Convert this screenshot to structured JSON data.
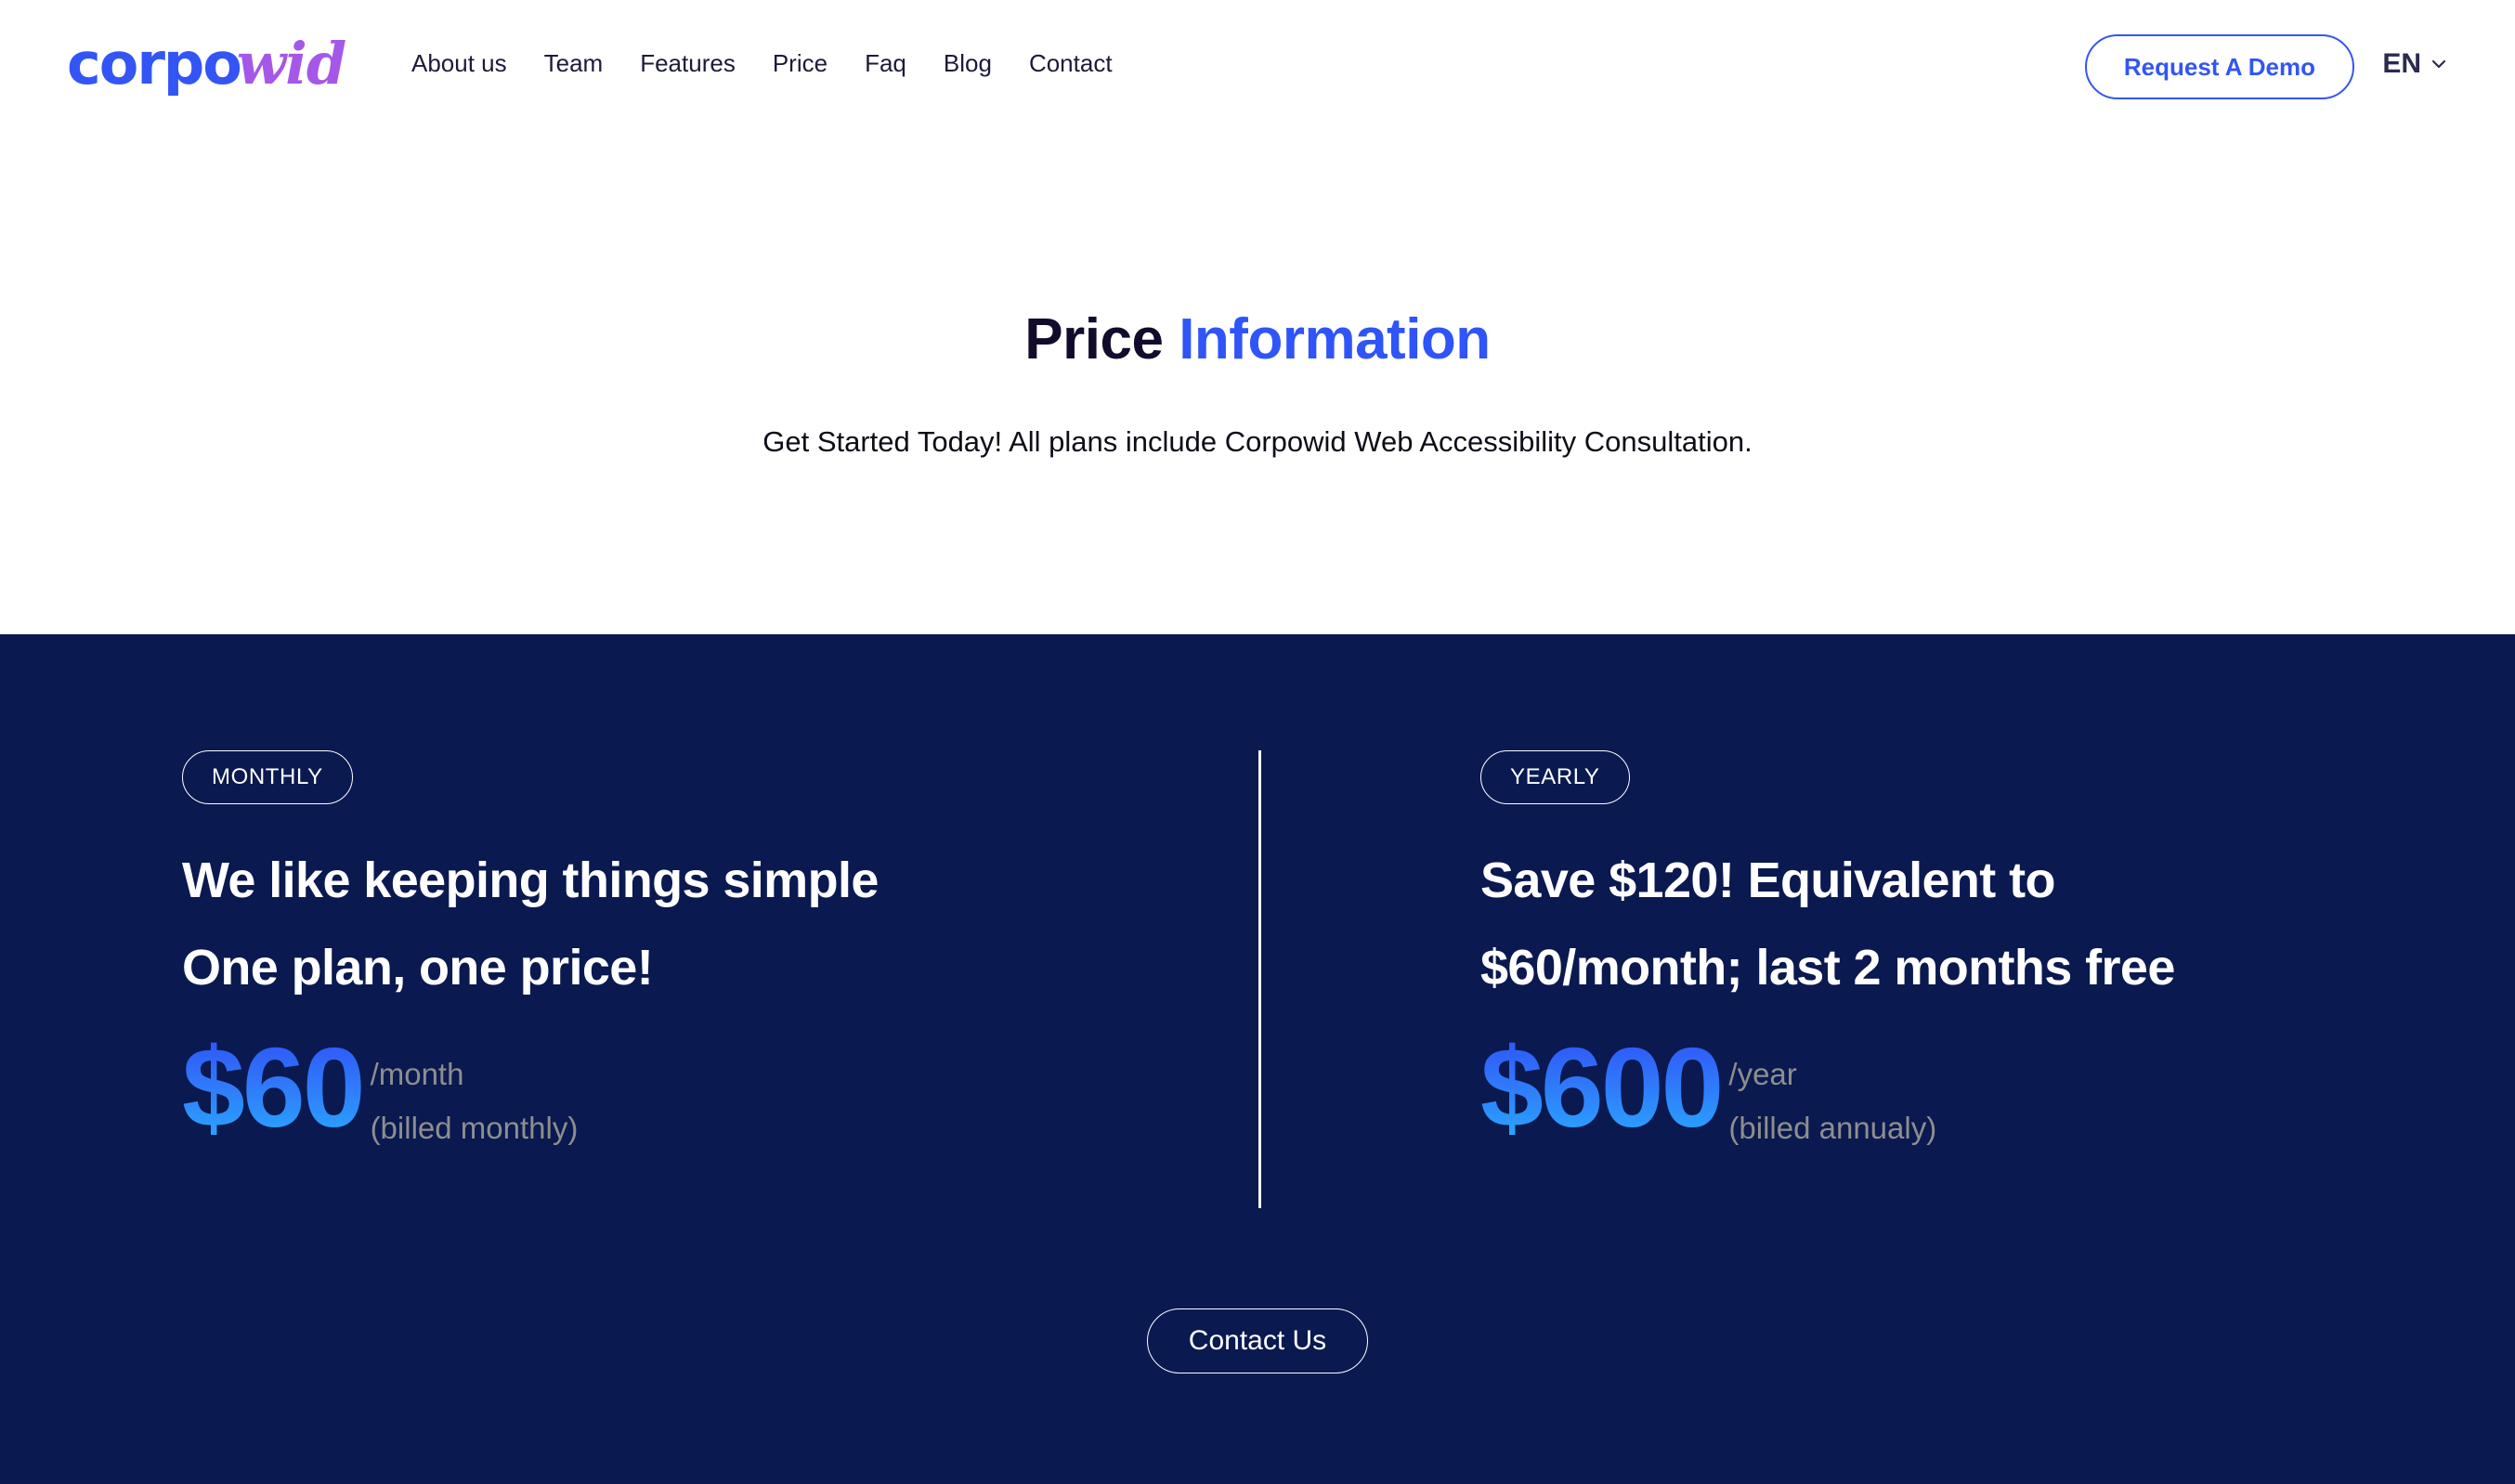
{
  "header": {
    "logo": {
      "part1": "corpo",
      "part2": "wid",
      "color1": "#3355F5",
      "color2": "#A557E8"
    },
    "nav_items": [
      {
        "label": "About us"
      },
      {
        "label": "Team"
      },
      {
        "label": "Features"
      },
      {
        "label": "Price"
      },
      {
        "label": "Faq"
      },
      {
        "label": "Blog"
      },
      {
        "label": "Contact"
      }
    ],
    "demo_button": "Request A Demo",
    "language": {
      "label": "EN",
      "icon": "chevron-down-icon"
    },
    "accent_color": "#3355F5"
  },
  "hero": {
    "title_dark": "Price",
    "title_blue": "Information",
    "subtitle": "Get Started Today! All plans include Corpowid Web Accessibility Consultation."
  },
  "pricing": {
    "background_color": "#0A1950",
    "plans": [
      {
        "badge": "MONTHLY",
        "headline_line1": "We like keeping things simple",
        "headline_line2": "One plan, one price!",
        "amount": "$60",
        "period": "/month",
        "billing_note": "(billed monthly)"
      },
      {
        "badge": "YEARLY",
        "headline_line1": "Save $120! Equivalent to",
        "headline_line2": "$60/month; last 2 months free",
        "amount": "$600",
        "period": "/year",
        "billing_note": "(billed annualy)"
      }
    ],
    "contact_button": "Contact Us"
  }
}
